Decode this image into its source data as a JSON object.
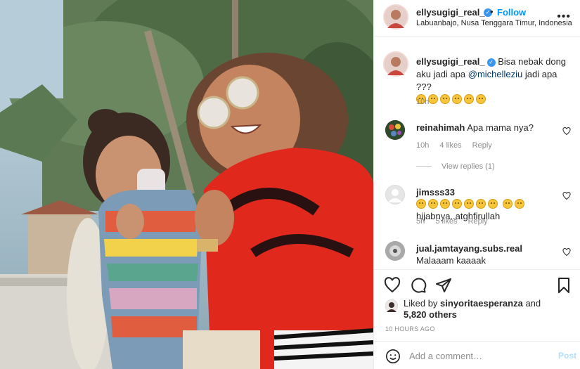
{
  "header": {
    "username": "ellysugigi_real_",
    "separator": "•",
    "follow_label": "Follow",
    "location": "Labuanbajo, Nusa Tenggara Timur, Indonesia",
    "more_icon": "more-horizontal-icon"
  },
  "caption": {
    "username": "ellysugigi_real_",
    "text_before": "Bisa nebak dong aku jadi apa",
    "mention": "@michelleziu",
    "text_after": "jadi apa ???",
    "emoji_icon": "sweat-smile-emoji",
    "time": "10h"
  },
  "comments": [
    {
      "username": "reinahimah",
      "text": "Apa mama nya?",
      "time": "10h",
      "likes": "4 likes",
      "reply": "Reply",
      "view_replies": "View replies (1)"
    },
    {
      "username": "jimsss33",
      "text": "hijabnya..atghfirullah",
      "time": "5h",
      "likes": "5 likes",
      "reply": "Reply"
    },
    {
      "username": "jual.jamtayang.subs.real",
      "text": "Malaaam kaaaak"
    }
  ],
  "actions": {
    "liked_by_prefix": "Liked by",
    "liked_by_user": "sinyoritaesperanza",
    "liked_by_and": "and",
    "liked_by_count": "5,820 others",
    "timeago": "10 HOURS AGO"
  },
  "add_comment": {
    "placeholder": "Add a comment…",
    "post_label": "Post"
  },
  "colors": {
    "link": "#0095f6",
    "verified": "#3897f0",
    "muted": "#8e8e8e",
    "post_disabled": "#b2dffc"
  }
}
